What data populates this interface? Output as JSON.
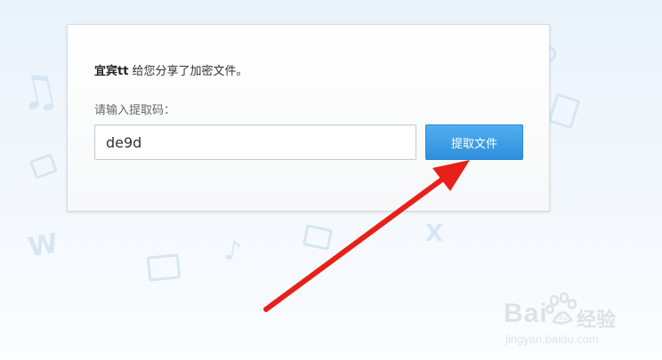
{
  "share": {
    "user": "宜宾tt",
    "message": "给您分享了加密文件。"
  },
  "extract": {
    "label": "请输入提取码：",
    "code_value": "de9d",
    "button_label": "提取文件"
  },
  "annotation": {
    "color": "#e8201a"
  },
  "watermark": {
    "brand_left": "Bai",
    "brand_right": "经验",
    "url": "jingyan.baidu.com"
  }
}
